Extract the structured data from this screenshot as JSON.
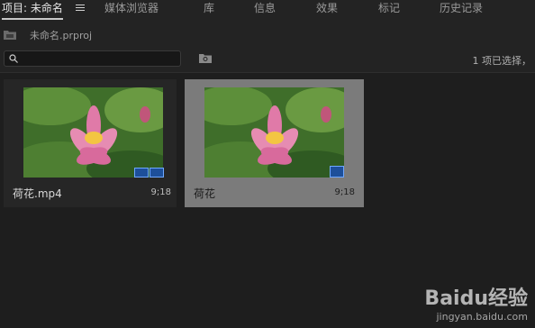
{
  "tabs": [
    {
      "label": "项目: 未命名",
      "active": true
    },
    {
      "label": "媒体浏览器"
    },
    {
      "label": "库"
    },
    {
      "label": "信息"
    },
    {
      "label": "效果"
    },
    {
      "label": "标记"
    },
    {
      "label": "历史记录"
    }
  ],
  "project": {
    "file": "未命名.prproj"
  },
  "search": {
    "placeholder": ""
  },
  "status": {
    "selection": "1 项已选择，"
  },
  "items": [
    {
      "name": "荷花.mp4",
      "duration": "9;18",
      "selected": false
    },
    {
      "name": "荷花",
      "duration": "9;18",
      "selected": true
    }
  ],
  "watermark": {
    "logo": "Baidu经验",
    "url": "jingyan.baidu.com"
  },
  "colors": {
    "accent_badge": "#1d4f9a",
    "selected_bg": "#7b7b7b"
  }
}
